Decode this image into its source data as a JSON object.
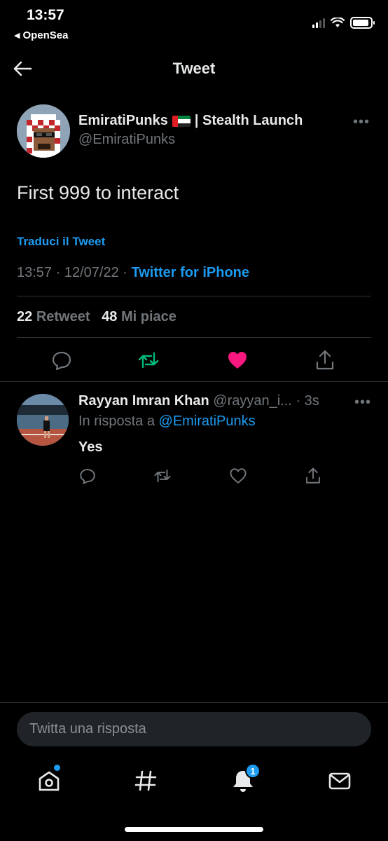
{
  "status_bar": {
    "time": "13:57",
    "back_app": "OpenSea"
  },
  "header": {
    "title": "Tweet"
  },
  "tweet": {
    "author_name": "EmiratiPunks",
    "author_name_suffix": "| Stealth Launch",
    "author_handle": "@EmiratiPunks",
    "text": "First 999 to interact",
    "translate_label": "Traduci il Tweet",
    "time": "13:57",
    "date": "12/07/22",
    "source": "Twitter for iPhone",
    "retweet_count": "22",
    "retweet_label": "Retweet",
    "like_count": "48",
    "like_label": "Mi piace",
    "liked": true,
    "colors": {
      "retweet": "#00ba7c",
      "like": "#f91880",
      "link": "#1d9bf0"
    }
  },
  "reply": {
    "author_name": "Rayyan Imran Khan",
    "author_handle": "@rayyan_i...",
    "age": "3s",
    "reply_to_prefix": "In risposta a",
    "reply_to_handle": "@EmiratiPunks",
    "text": "Yes"
  },
  "composer": {
    "placeholder": "Twitta una risposta"
  },
  "tabbar": {
    "notifications_badge": "1",
    "icons": [
      "home-icon",
      "hashtag-icon",
      "bell-icon",
      "mail-icon"
    ]
  }
}
